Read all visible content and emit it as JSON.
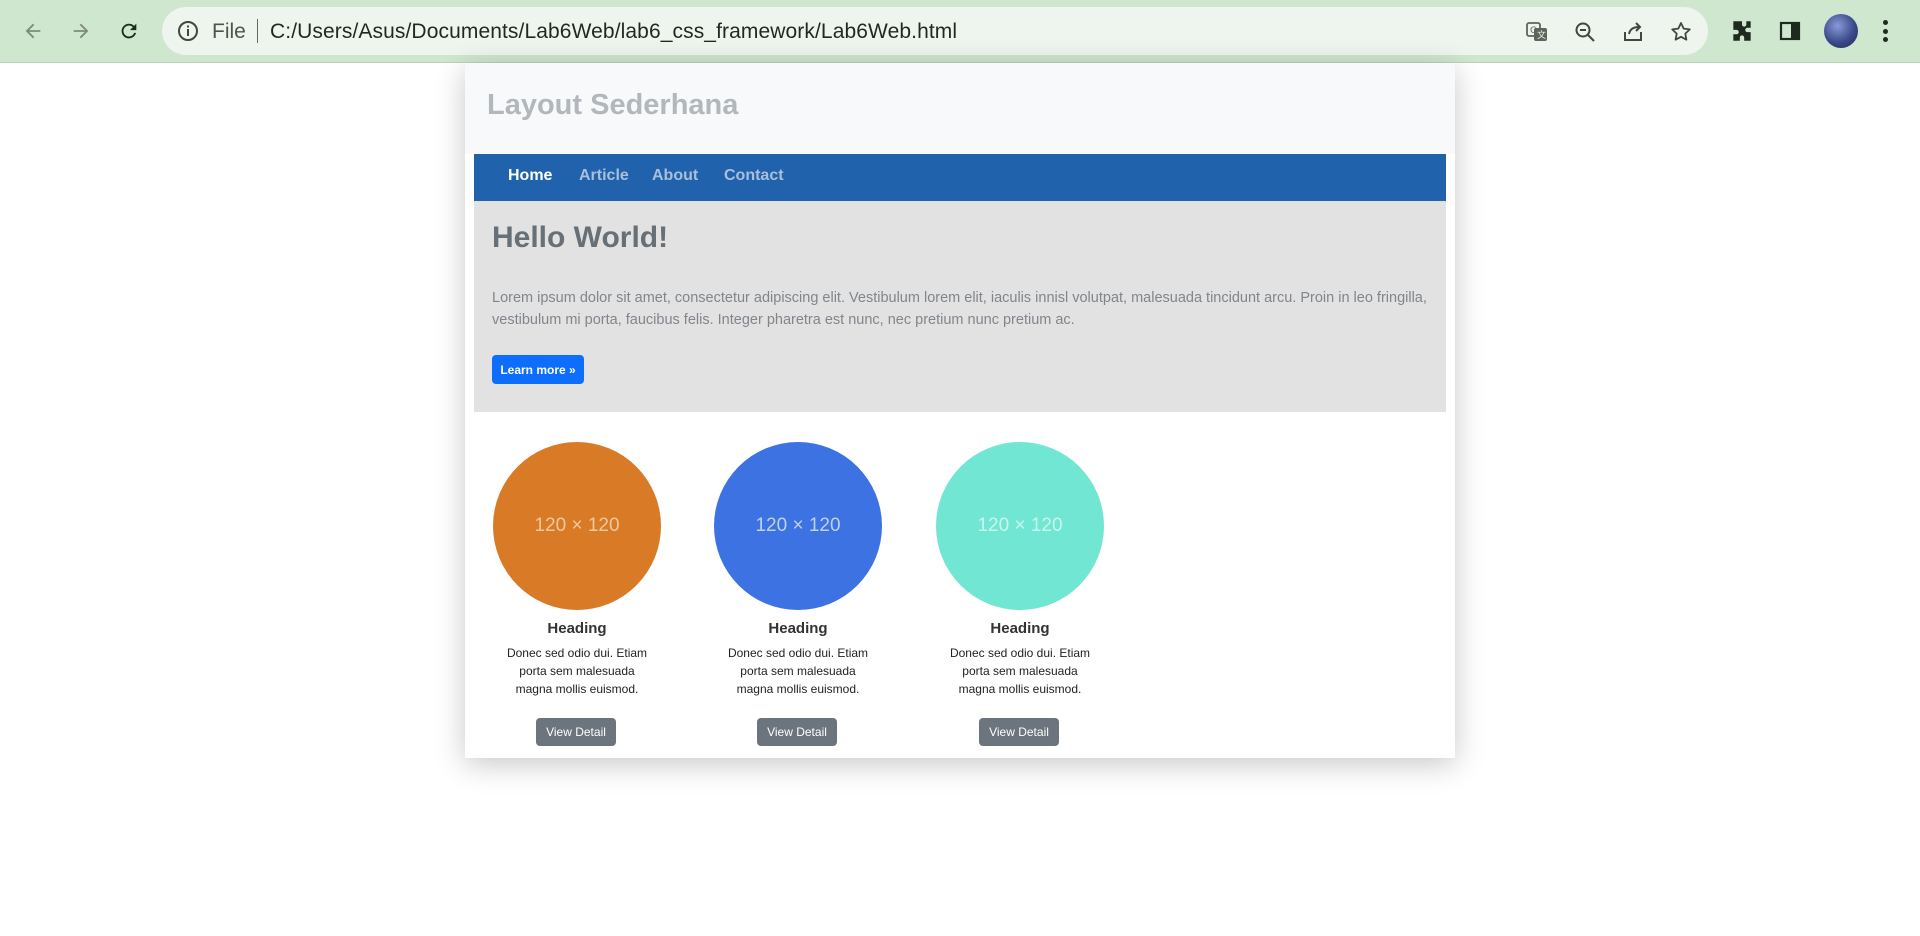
{
  "browser": {
    "scheme_label": "File",
    "url": "C:/Users/Asus/Documents/Lab6Web/lab6_css_framework/Lab6Web.html"
  },
  "site": {
    "title": "Layout Sederhana",
    "nav": [
      {
        "label": "Home",
        "active": true
      },
      {
        "label": "Article",
        "active": false
      },
      {
        "label": "About",
        "active": false
      },
      {
        "label": "Contact",
        "active": false
      }
    ]
  },
  "hero": {
    "title": "Hello World!",
    "text": "Lorem ipsum dolor sit amet, consectetur adipiscing elit. Vestibulum lorem elit, iaculis innisl volutpat, malesuada tincidunt arcu. Proin in leo fringilla, vestibulum mi porta, faucibus felis. Integer pharetra est nunc, nec pretium nunc pretium ac.",
    "button": "Learn more »"
  },
  "cards": [
    {
      "image_label": "120 × 120",
      "color": "#d97a26",
      "text_color": "#f0c8a0",
      "heading": "Heading",
      "text": "Donec sed odio dui. Etiam porta sem malesuada magna mollis euismod.",
      "button": "View Detail"
    },
    {
      "image_label": "120 × 120",
      "color": "#3d72e3",
      "text_color": "#bfd0f3",
      "heading": "Heading",
      "text": "Donec sed odio dui. Etiam porta sem malesuada magna mollis euismod.",
      "button": "View Detail"
    },
    {
      "image_label": "120 × 120",
      "color": "#71e6d2",
      "text_color": "#c8f6ee",
      "heading": "Heading",
      "text": "Donec sed odio dui. Etiam porta sem malesuada magna mollis euismod.",
      "button": "View Detail"
    }
  ]
}
